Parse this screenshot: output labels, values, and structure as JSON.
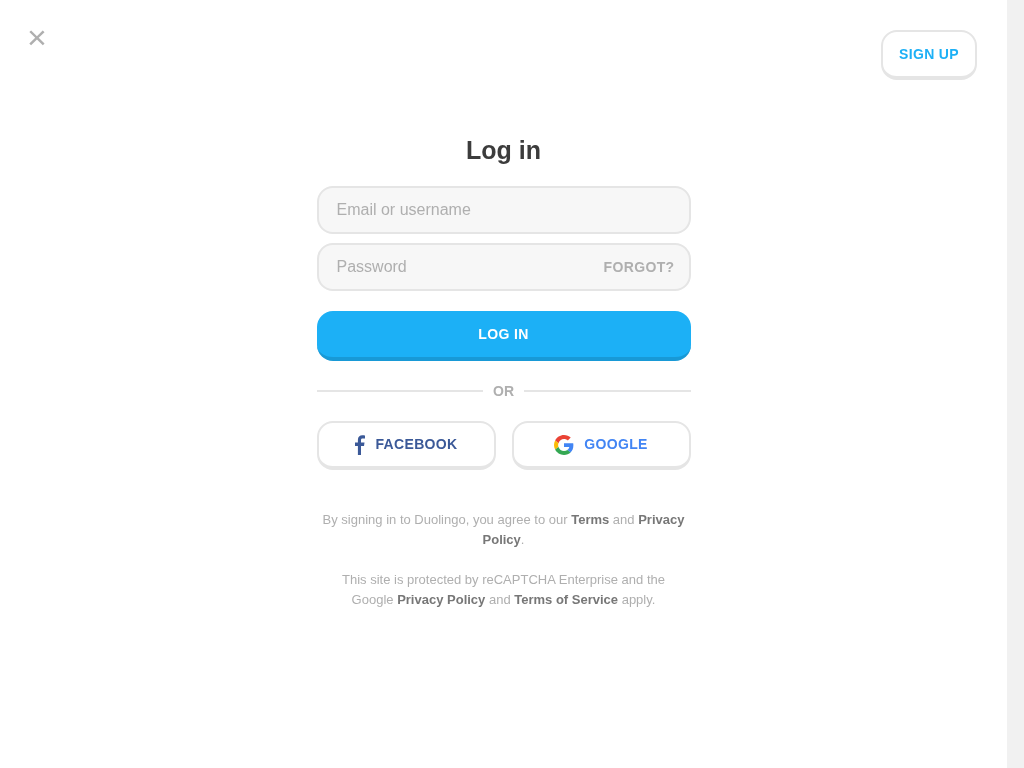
{
  "close_button": {
    "label": "×"
  },
  "signup_button": {
    "label": "SIGN UP"
  },
  "title": "Log in",
  "fields": [
    {
      "placeholder": "Email or username"
    },
    {
      "placeholder": "Password",
      "action": "FORGOT?"
    }
  ],
  "login_button": {
    "label": "LOG IN"
  },
  "divider": "OR",
  "social_buttons": [
    {
      "kind": "facebook",
      "label": "FACEBOOK"
    },
    {
      "kind": "google",
      "label": "GOOGLE"
    }
  ],
  "legal": [
    "By signing in to Duolingo, you agree to our **Terms** and **Privacy Policy**.",
    "This site is protected by reCAPTCHA Enterprise and the Google **Privacy Policy** and **Terms of Service** apply."
  ]
}
